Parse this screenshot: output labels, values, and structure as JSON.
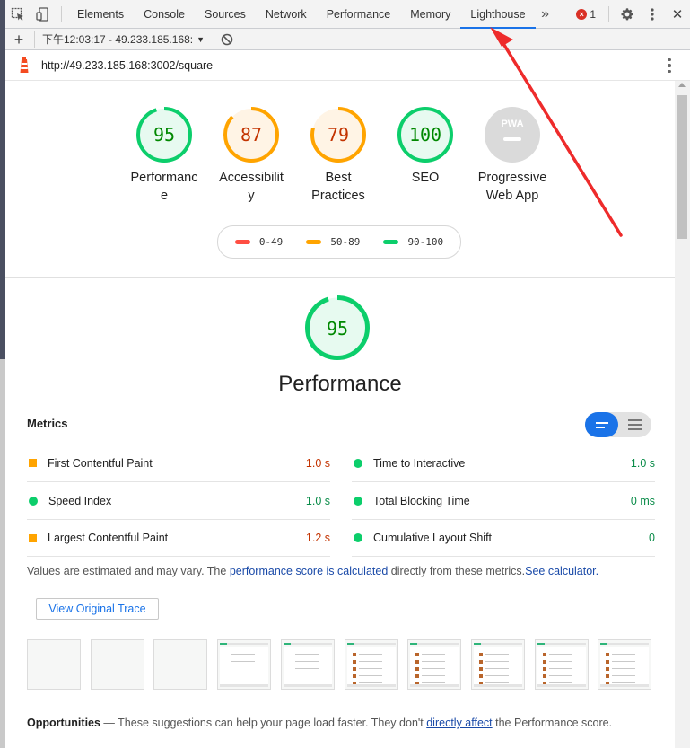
{
  "devtools": {
    "tabs": [
      "Elements",
      "Console",
      "Sources",
      "Network",
      "Performance",
      "Memory",
      "Lighthouse"
    ],
    "active_tab": "Lighthouse",
    "more_tabs_glyph": "»",
    "error_count": "1",
    "error_glyph": "×",
    "close_glyph": "✕"
  },
  "lighthouse_toolbar": {
    "add_glyph": "+",
    "report_label": "下午12:03:17 - 49.233.185.168:"
  },
  "url_bar": {
    "url": "http://49.233.185.168:3002/square"
  },
  "summary": {
    "gauges": [
      {
        "score": "95",
        "label_line1": "Performanc",
        "label_line2": "e",
        "rating": "pass",
        "value": 95
      },
      {
        "score": "87",
        "label_line1": "Accessibilit",
        "label_line2": "y",
        "rating": "average",
        "value": 87
      },
      {
        "score": "79",
        "label_line1": "Best",
        "label_line2": "Practices",
        "rating": "average",
        "value": 79
      },
      {
        "score": "100",
        "label_line1": "SEO",
        "label_line2": "",
        "rating": "pass",
        "value": 100
      }
    ],
    "pwa": {
      "badge": "PWA",
      "label_line1": "Progressive",
      "label_line2": "Web App"
    }
  },
  "legend": [
    {
      "label": "0-49",
      "color": "#ff4e42"
    },
    {
      "label": "50-89",
      "color": "#ffa400"
    },
    {
      "label": "90-100",
      "color": "#0cce6b"
    }
  ],
  "performance": {
    "score": "95",
    "value": 95,
    "title": "Performance",
    "metrics_heading": "Metrics",
    "metrics_left": [
      {
        "name": "First Contentful Paint",
        "value": "1.0 s",
        "rating": "average"
      },
      {
        "name": "Speed Index",
        "value": "1.0 s",
        "rating": "pass"
      },
      {
        "name": "Largest Contentful Paint",
        "value": "1.2 s",
        "rating": "average"
      }
    ],
    "metrics_right": [
      {
        "name": "Time to Interactive",
        "value": "1.0 s",
        "rating": "pass"
      },
      {
        "name": "Total Blocking Time",
        "value": "0 ms",
        "rating": "pass"
      },
      {
        "name": "Cumulative Layout Shift",
        "value": "0",
        "rating": "pass"
      }
    ],
    "note_prefix": "Values are estimated and may vary. The ",
    "note_link": "performance score is calculated",
    "note_middle": " directly from these metrics.",
    "note_link2": "See calculator.",
    "trace_button": "View Original Trace",
    "filmstrip_frames": 10,
    "opportunities_heading": "Opportunities",
    "opportunities_prefix": " — These suggestions can help your page load faster. They don't ",
    "opportunities_link": "directly affect",
    "opportunities_suffix": " the Performance score."
  },
  "colors": {
    "pass": "#0cce6b",
    "pass_text": "#008800",
    "average": "#ffa400",
    "average_text": "#c33300",
    "fail": "#ff4e42",
    "accent": "#1a73e8",
    "annotation_arrow": "#ee2b2b"
  }
}
